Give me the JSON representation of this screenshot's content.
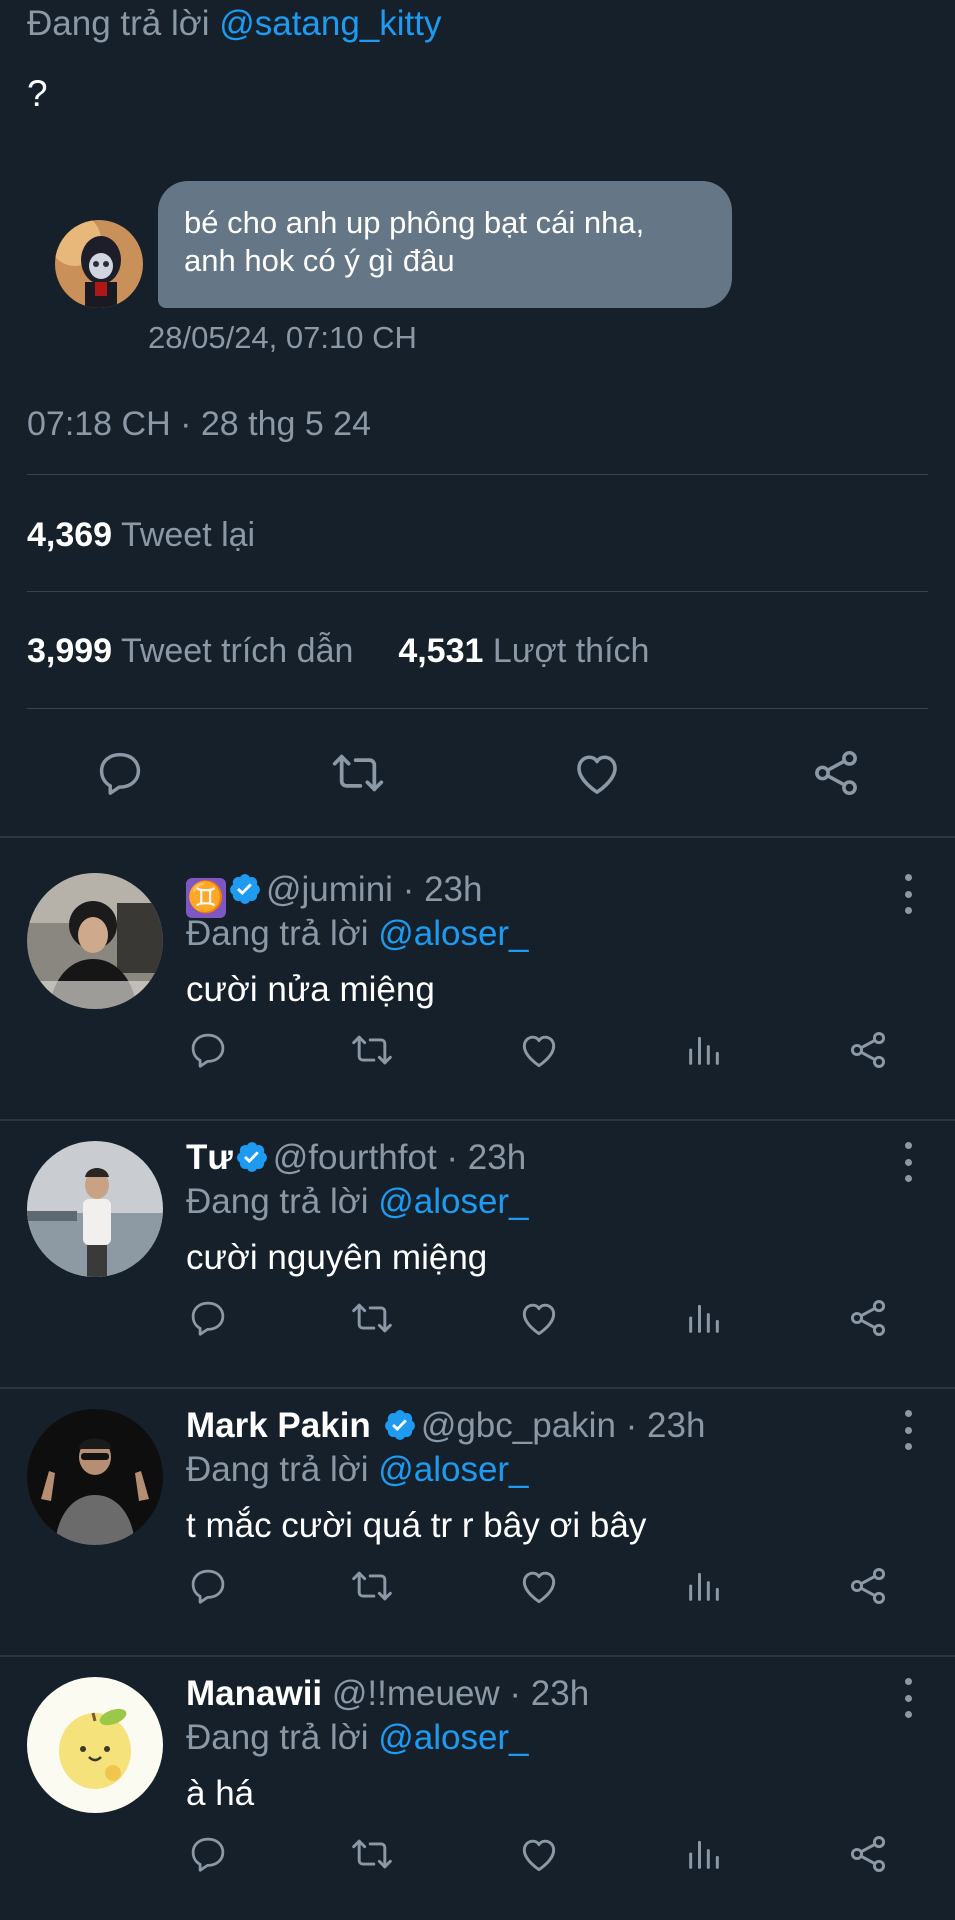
{
  "tweet": {
    "reply_prefix": "Đang trả lời",
    "reply_handle": "@satang_kitty",
    "text": "?",
    "dm": {
      "line1": "bé cho anh up phông bạt cái nha,",
      "line2": "anh hok có ý gì đâu",
      "timestamp": "28/05/24, 07:10 CH"
    },
    "post_time": "07:18 CH · 28 thg 5 24",
    "retweets": {
      "count": "4,369",
      "label": "Tweet lại"
    },
    "quotes": {
      "count": "3,999",
      "label": "Tweet trích dẫn"
    },
    "likes": {
      "count": "4,531",
      "label": "Lượt thích"
    },
    "actions": [
      "reply-icon",
      "retweet-icon",
      "like-icon",
      "share-icon"
    ]
  },
  "replies": [
    {
      "name": "♊",
      "verified": true,
      "handle": "@jumini",
      "time": "· 23h",
      "reply_prefix": "Đang trả lời",
      "reply_to": "@aloser_",
      "text": "cười nửa miệng"
    },
    {
      "name": "Tư",
      "verified": true,
      "handle": "@fourthfot",
      "time": "· 23h",
      "reply_prefix": "Đang trả lời",
      "reply_to": "@aloser_",
      "text": "cười nguyên miệng"
    },
    {
      "name": "Mark Pakin",
      "verified": true,
      "handle": "@gbc_pakin",
      "time": "· 23h",
      "reply_prefix": "Đang trả lời",
      "reply_to": "@aloser_",
      "text": "t mắc cười quá tr r bây ơi bây"
    },
    {
      "name": "Manawii",
      "verified": false,
      "handle": "@!!meuew",
      "time": "· 23h",
      "reply_prefix": "Đang trả lời",
      "reply_to": "@aloser_",
      "text": "à há"
    }
  ],
  "colors": {
    "background": "#15202b",
    "muted": "#8b98a5",
    "link": "#1d9bf0",
    "divider": "#38444d",
    "dm_bubble": "#657786"
  }
}
